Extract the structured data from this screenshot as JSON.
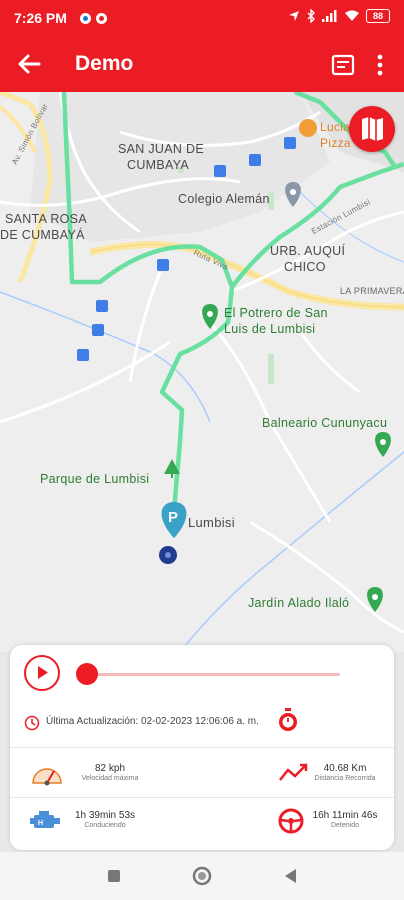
{
  "status_bar": {
    "time": "7:26 PM",
    "battery": "88"
  },
  "app_bar": {
    "title": "Demo"
  },
  "map": {
    "labels": {
      "san_juan": "SAN JUAN DE",
      "cumbaya": "CUMBAYA",
      "santa_rosa": "SANTA ROSA",
      "de_cumbaya": "DE CUMBAYÁ",
      "colegio": "Colegio Alemán",
      "urb": "URB. AUQUÍ",
      "chico": "CHICO",
      "primavera": "LA PRIMAVERA",
      "potrero1": "El Potrero de San",
      "potrero2": "Luis de Lumbisi",
      "balneario": "Balneario Cununyacu",
      "parque": "Parque de Lumbisi",
      "lumbisi": "Lumbisi",
      "jardin": "Jardín Alado Ilaló",
      "lucia": "Lucia",
      "pizza": "Pizza",
      "road_simon": "Av. Simón Bolívar",
      "road_ruta": "Ruta Viva",
      "road_estacion": "Estación Lumbisi"
    },
    "colors": {
      "route": "#69e0a0",
      "accent": "#ec1c24",
      "parking": "#3aa1c7",
      "end_point": "#1f3b8c"
    }
  },
  "playback": {
    "progress": 0.0,
    "last_update_label": "Última Actualización:",
    "last_update_value": "02-02-2023 12:06:06 a. m."
  },
  "stats": {
    "max_speed": {
      "value": "82 kph",
      "label": "Velocidad máxima"
    },
    "distance": {
      "value": "40.68 Km",
      "label": "Distancia Recorrida"
    },
    "driving": {
      "value": "1h 39min 53s",
      "label": "Conduciendo"
    },
    "stopped": {
      "value": "16h 11min 46s",
      "label": "Detenido"
    }
  }
}
